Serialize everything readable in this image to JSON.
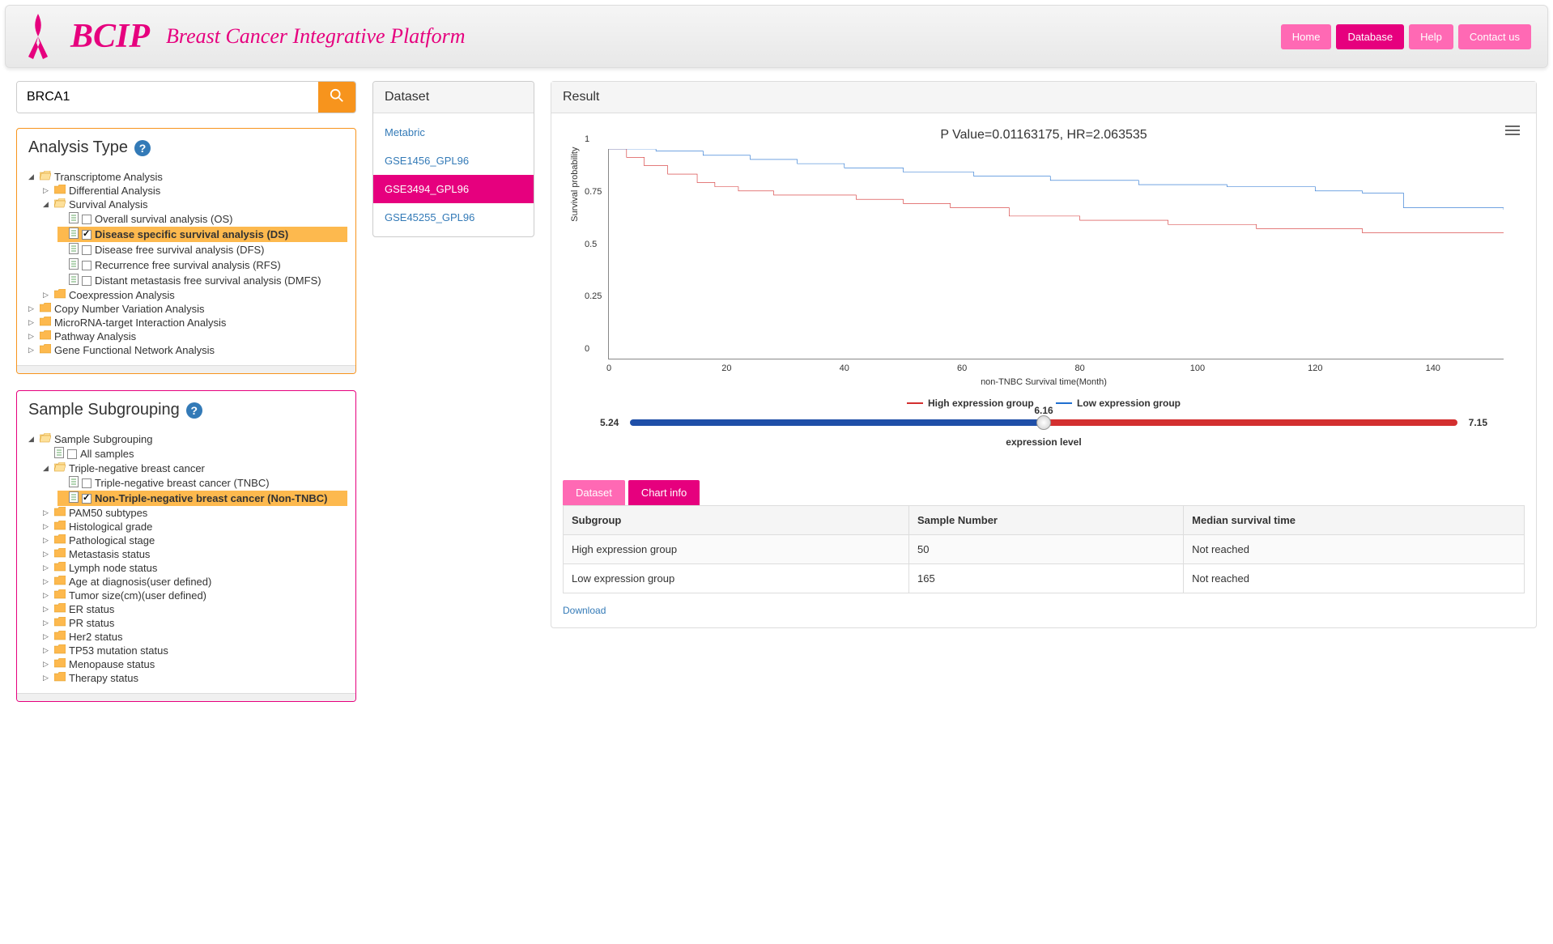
{
  "header": {
    "brand": "BCIP",
    "tagline": "Breast Cancer Integrative Platform",
    "nav": [
      "Home",
      "Database",
      "Help",
      "Contact us"
    ],
    "nav_active": 1
  },
  "search": {
    "value": "BRCA1"
  },
  "analysis_panel": {
    "title": "Analysis Type",
    "tree": {
      "root": "Transcriptome Analysis",
      "differential": "Differential Analysis",
      "survival": "Survival Analysis",
      "survival_items": [
        "Overall survival analysis (OS)",
        "Disease specific survival analysis (DS)",
        "Disease free survival analysis (DFS)",
        "Recurrence free survival analysis (RFS)",
        "Distant metastasis free survival analysis (DMFS)"
      ],
      "survival_selected": 1,
      "coexpr": "Coexpression Analysis",
      "siblings": [
        "Copy Number Variation Analysis",
        "MicroRNA-target Interaction Analysis",
        "Pathway Analysis",
        "Gene Functional Network Analysis"
      ]
    }
  },
  "subgroup_panel": {
    "title": "Sample Subgrouping",
    "root": "Sample Subgrouping",
    "all_samples": "All samples",
    "tnbc_group": "Triple-negative breast cancer",
    "tnbc_items": [
      "Triple-negative breast cancer (TNBC)",
      "Non-Triple-negative breast cancer (Non-TNBC)"
    ],
    "tnbc_selected": 1,
    "others": [
      "PAM50 subtypes",
      "Histological grade",
      "Pathological stage",
      "Metastasis status",
      "Lymph node status",
      "Age at diagnosis(user defined)",
      "Tumor size(cm)(user defined)",
      "ER status",
      "PR status",
      "Her2 status",
      "TP53 mutation status",
      "Menopause status",
      "Therapy status"
    ]
  },
  "dataset_panel": {
    "title": "Dataset",
    "items": [
      "Metabric",
      "GSE1456_GPL96",
      "GSE3494_GPL96",
      "GSE45255_GPL96"
    ],
    "active": 2
  },
  "result": {
    "title": "Result",
    "chart_title": "P Value=0.01163175, HR=2.063535",
    "ylabel": "Survival probability",
    "xlabel": "non-TNBC Survival time(Month)",
    "legend": {
      "high": "High expression group",
      "low": "Low expression group"
    },
    "slider": {
      "min": "5.24",
      "mid": "6.16",
      "max": "7.15",
      "label": "expression level"
    },
    "tabs": [
      "Dataset",
      "Chart info"
    ],
    "tab_active": 0,
    "table": {
      "headers": [
        "Subgroup",
        "Sample Number",
        "Median survival time"
      ],
      "rows": [
        [
          "High expression group",
          "50",
          "Not reached"
        ],
        [
          "Low expression group",
          "165",
          "Not reached"
        ]
      ]
    },
    "download": "Download"
  },
  "chart_data": {
    "type": "line",
    "title": "P Value=0.01163175, HR=2.063535",
    "xlabel": "non-TNBC Survival time(Month)",
    "ylabel": "Survival probability",
    "xlim": [
      0,
      152
    ],
    "ylim": [
      0,
      1
    ],
    "xticks": [
      0,
      20,
      40,
      60,
      80,
      100,
      120,
      140
    ],
    "yticks": [
      0,
      0.25,
      0.5,
      0.75,
      1
    ],
    "series": [
      {
        "name": "High expression group",
        "color": "#d32f2f",
        "x": [
          0,
          3,
          6,
          10,
          15,
          18,
          22,
          28,
          35,
          42,
          50,
          58,
          68,
          80,
          95,
          110,
          128,
          152
        ],
        "y": [
          1.0,
          0.96,
          0.92,
          0.88,
          0.84,
          0.82,
          0.8,
          0.78,
          0.78,
          0.76,
          0.74,
          0.72,
          0.68,
          0.66,
          0.64,
          0.62,
          0.6,
          0.6
        ]
      },
      {
        "name": "Low expression group",
        "color": "#1f6fd0",
        "x": [
          0,
          8,
          16,
          24,
          32,
          40,
          50,
          62,
          75,
          90,
          105,
          120,
          128,
          135,
          152
        ],
        "y": [
          1.0,
          0.99,
          0.97,
          0.95,
          0.93,
          0.91,
          0.89,
          0.87,
          0.85,
          0.83,
          0.82,
          0.8,
          0.79,
          0.72,
          0.71
        ]
      }
    ]
  }
}
